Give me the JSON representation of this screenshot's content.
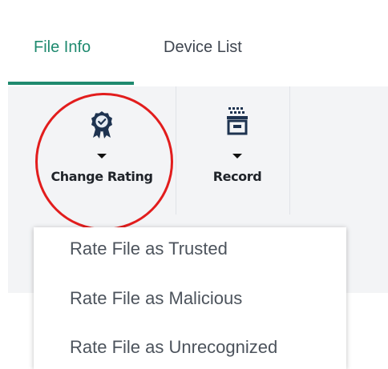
{
  "tabs": [
    {
      "label": "File Info",
      "active": true
    },
    {
      "label": "Device List",
      "active": false
    }
  ],
  "toolbar": {
    "change_rating": {
      "label": "Change Rating",
      "icon": "award-badge-icon"
    },
    "record": {
      "label": "Record",
      "icon": "archive-box-icon"
    }
  },
  "dropdown": {
    "items": [
      "Rate File as Trusted",
      "Rate File as Malicious",
      "Rate File as Unrecognized"
    ]
  },
  "colors": {
    "accent": "#1f8a6f",
    "highlight": "#e21d1d",
    "icon": "#1e3350"
  }
}
